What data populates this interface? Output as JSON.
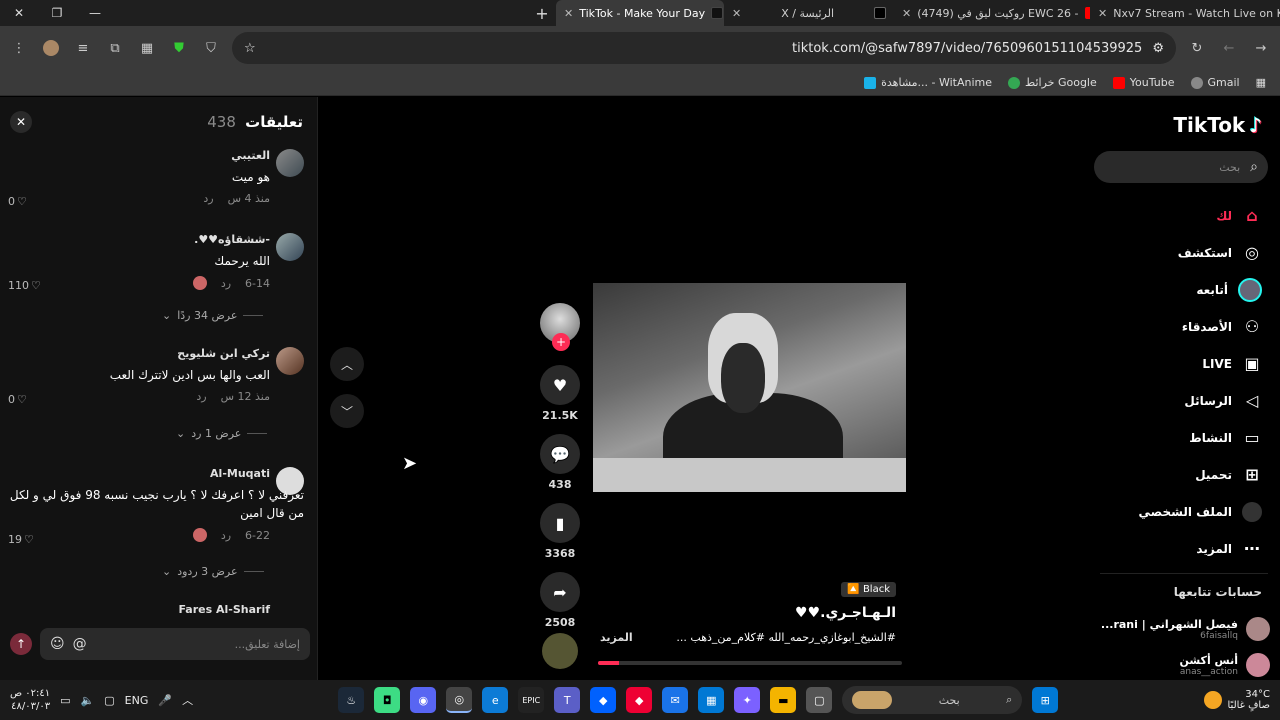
{
  "browser": {
    "tabs": [
      {
        "title": "Nxv7 Stream - Watch Live on K",
        "color": "#53fc18"
      },
      {
        "title": "(4749) روكيت ليق في EWC 26 -",
        "color": "#ff0000"
      },
      {
        "title": "X / الرئيسة",
        "color": "#000000"
      },
      {
        "title": "TikTok - Make Your Day",
        "color": "#000000"
      }
    ],
    "url": "tiktok.com/@safw7897/video/7650960151104539925",
    "bookmarks": [
      "Gmail",
      "YouTube",
      "خرائط Google",
      "مشاهدة... - WitAnime"
    ]
  },
  "comments": {
    "title": "تعليقات",
    "count": "438",
    "items": [
      {
        "user": "العتيبي",
        "text": "هو ميت",
        "time": "منذ 4 س",
        "reply": "رد",
        "likes": "0"
      },
      {
        "user": "-ششقاؤه♥♥.",
        "text": "الله يرحمك",
        "time": "6-14",
        "reply": "رد",
        "likes": "110",
        "replies": "عرض 34 ردًا"
      },
      {
        "user": "تركي ابن شليويح",
        "text": "العب والها بس ادين لاتترك العب",
        "time": "منذ 12 س",
        "reply": "رد",
        "likes": "0",
        "replies": "عرض 1 رد"
      },
      {
        "user": "Al-Muqati",
        "text": "تعرفني لا ؟ اعرفك لا ؟ يارب نجيب نسبه 98 فوق لي و لكل من قال امين",
        "time": "6-22",
        "reply": "رد",
        "likes": "19",
        "replies": "عرض 3 ردود"
      },
      {
        "user": "Fares Al-Sharif"
      }
    ],
    "input_placeholder": "إضافة تعليق..."
  },
  "video": {
    "tag": "Black 🔼",
    "title": "الـهـاجـري.♥♥",
    "description": "#الشيخ_ابوغازي_رحمه_الله #كلام_من_ذهب ...",
    "more": "المزيد",
    "progress": 0.07
  },
  "actions": {
    "likes": "21.5K",
    "comments": "438",
    "saves": "3368",
    "shares": "2508"
  },
  "sidebar": {
    "logo": "TikTok",
    "search_placeholder": "بحث",
    "nav": [
      {
        "label": "لك",
        "icon": "home-icon",
        "active": true
      },
      {
        "label": "استكشف",
        "icon": "compass-icon"
      },
      {
        "label": "أتابعه",
        "icon": "avatar"
      },
      {
        "label": "الأصدقاء",
        "icon": "friends-icon"
      },
      {
        "label": "LIVE",
        "icon": "live-icon"
      },
      {
        "label": "الرسائل",
        "icon": "send-icon"
      },
      {
        "label": "النشاط",
        "icon": "inbox-icon"
      },
      {
        "label": "تحميل",
        "icon": "upload-icon"
      },
      {
        "label": "الملف الشخصي",
        "icon": "profile-icon"
      },
      {
        "label": "المزيد",
        "icon": "more-icon"
      }
    ],
    "following_title": "حسابات تتابعها",
    "following": [
      {
        "name": "فيصل الشهراني | rani...",
        "handle": "6faisallq"
      },
      {
        "name": "أنس أكشن",
        "handle": "anas__action"
      }
    ]
  },
  "taskbar": {
    "time": "٠٢:٤١ ص",
    "date": "٤٨/٠٣/٠٣",
    "lang": "ENG",
    "search": "بحث",
    "weather_temp": "34°C",
    "weather_desc": "صافٍ غالبًا"
  }
}
